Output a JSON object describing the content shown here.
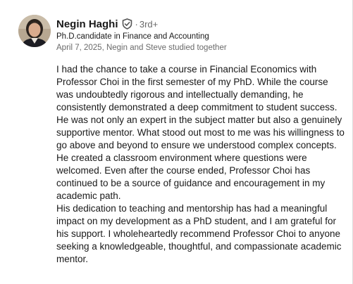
{
  "recommendation": {
    "author": {
      "name": "Negin Haghi",
      "separator": "·",
      "connection_degree": "3rd+",
      "headline": "Ph.D.candidate in Finance and Accounting",
      "verified_icon": "verified-shield-icon"
    },
    "meta": "April 7, 2025, Negin and Steve studied together",
    "paragraphs": [
      "I had the chance to take a course in Financial Economics with Professor Choi in the first semester of my PhD. While the course was undoubtedly rigorous and intellectually demanding, he consistently demonstrated a deep commitment to student success. He was not only an expert in the subject matter but also a genuinely supportive mentor. What stood out most to me was his willingness to go above and beyond to ensure we understood complex concepts. He created a classroom environment where questions were welcomed. Even after the course ended, Professor Choi has continued to be a source of guidance and encouragement in my academic path.",
      "His dedication to teaching and mentorship has had a meaningful impact on my development as a PhD student, and I am grateful for his support. I wholeheartedly recommend Professor Choi to anyone seeking a knowledgeable, thoughtful, and compassionate academic mentor."
    ]
  },
  "colors": {
    "primary_text": "#1a1a1a",
    "secondary_text": "#666666",
    "background": "#ffffff"
  }
}
